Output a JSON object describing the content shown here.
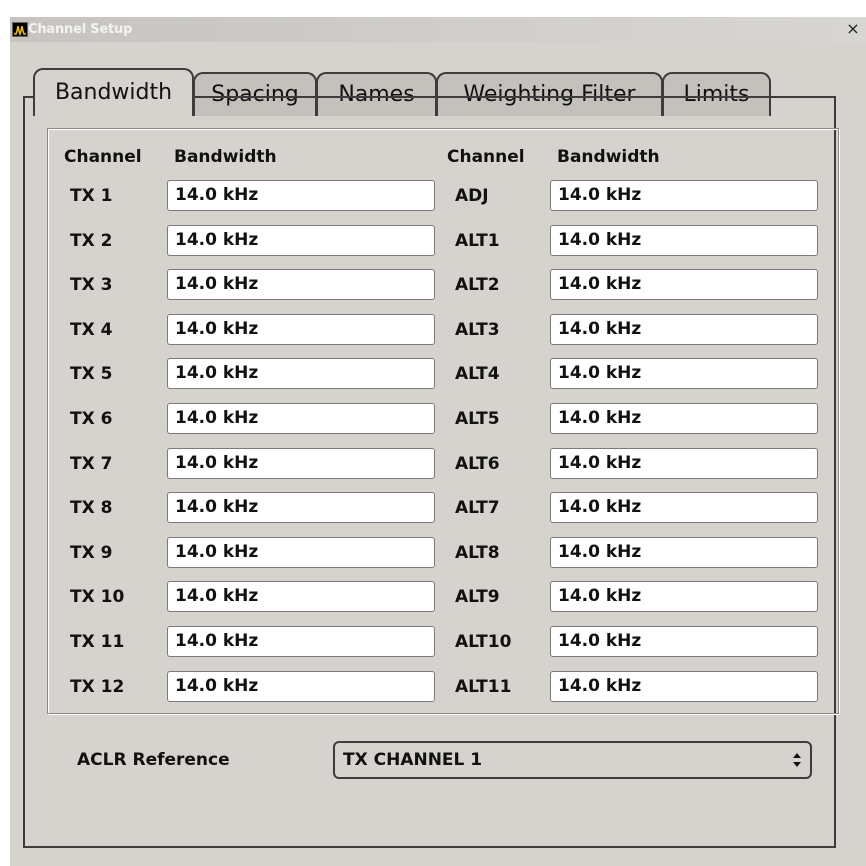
{
  "window": {
    "title": "Channel Setup",
    "close_label": "×"
  },
  "tabs": [
    {
      "label": "Bandwidth",
      "active": true
    },
    {
      "label": "Spacing",
      "active": false
    },
    {
      "label": "Names",
      "active": false
    },
    {
      "label": "Weighting Filter",
      "active": false
    },
    {
      "label": "Limits",
      "active": false
    }
  ],
  "headers": {
    "left_channel": "Channel",
    "left_bandwidth": "Bandwidth",
    "right_channel": "Channel",
    "right_bandwidth": "Bandwidth"
  },
  "rows": [
    {
      "tx": "TX 1",
      "tx_bw": "14.0 kHz",
      "adj": "ADJ",
      "adj_bw": "14.0 kHz"
    },
    {
      "tx": "TX 2",
      "tx_bw": "14.0 kHz",
      "adj": "ALT1",
      "adj_bw": "14.0 kHz"
    },
    {
      "tx": "TX 3",
      "tx_bw": "14.0 kHz",
      "adj": "ALT2",
      "adj_bw": "14.0 kHz"
    },
    {
      "tx": "TX 4",
      "tx_bw": "14.0 kHz",
      "adj": "ALT3",
      "adj_bw": "14.0 kHz"
    },
    {
      "tx": "TX 5",
      "tx_bw": "14.0 kHz",
      "adj": "ALT4",
      "adj_bw": "14.0 kHz"
    },
    {
      "tx": "TX 6",
      "tx_bw": "14.0 kHz",
      "adj": "ALT5",
      "adj_bw": "14.0 kHz"
    },
    {
      "tx": "TX 7",
      "tx_bw": "14.0 kHz",
      "adj": "ALT6",
      "adj_bw": "14.0 kHz"
    },
    {
      "tx": "TX 8",
      "tx_bw": "14.0 kHz",
      "adj": "ALT7",
      "adj_bw": "14.0 kHz"
    },
    {
      "tx": "TX 9",
      "tx_bw": "14.0 kHz",
      "adj": "ALT8",
      "adj_bw": "14.0 kHz"
    },
    {
      "tx": "TX 10",
      "tx_bw": "14.0 kHz",
      "adj": "ALT9",
      "adj_bw": "14.0 kHz"
    },
    {
      "tx": "TX 11",
      "tx_bw": "14.0 kHz",
      "adj": "ALT10",
      "adj_bw": "14.0 kHz"
    },
    {
      "tx": "TX 12",
      "tx_bw": "14.0 kHz",
      "adj": "ALT11",
      "adj_bw": "14.0 kHz"
    }
  ],
  "aclr": {
    "label": "ACLR Reference",
    "selected": "TX CHANNEL 1"
  },
  "colors": {
    "panel_bg": "#d6d3ce",
    "title_text": "#f3f3f3",
    "border": "#3c3c3c"
  },
  "icons": {
    "app": "spectrum-analyzer-icon",
    "close": "close-icon",
    "dropdown": "up-down-arrows-icon"
  }
}
